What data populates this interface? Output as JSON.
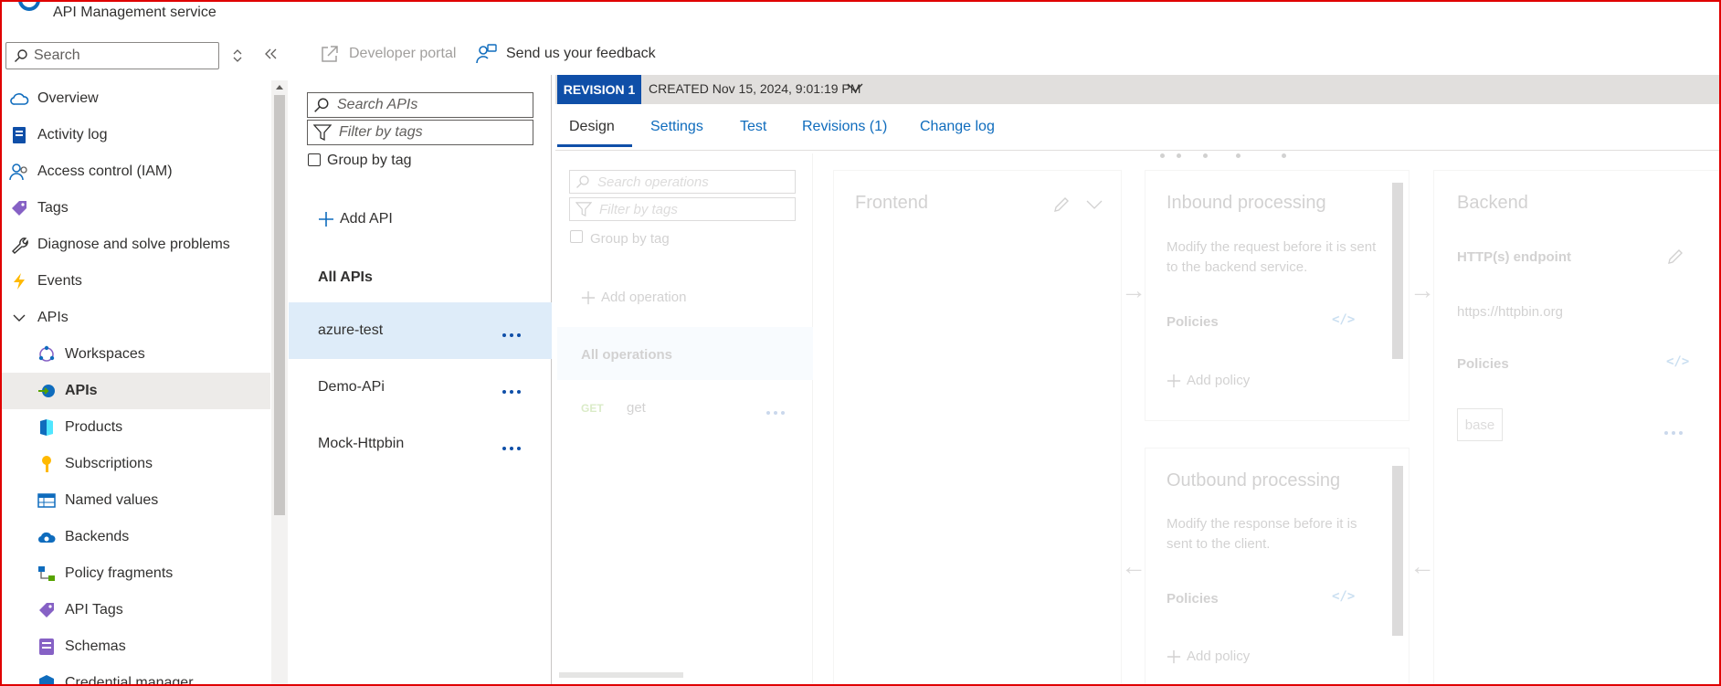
{
  "header": {
    "service_name": "API Management service"
  },
  "sidebar": {
    "search_placeholder": "Search",
    "items": [
      {
        "label": "Overview",
        "icon": "cloud-icon"
      },
      {
        "label": "Activity log",
        "icon": "log-icon"
      },
      {
        "label": "Access control (IAM)",
        "icon": "people-icon"
      },
      {
        "label": "Tags",
        "icon": "tag-icon"
      },
      {
        "label": "Diagnose and solve problems",
        "icon": "wrench-icon"
      },
      {
        "label": "Events",
        "icon": "lightning-icon"
      },
      {
        "label": "APIs",
        "icon": "chevron-down-icon"
      },
      {
        "label": "Workspaces",
        "icon": "workspaces-icon"
      },
      {
        "label": "APIs",
        "icon": "api-icon"
      },
      {
        "label": "Products",
        "icon": "products-icon"
      },
      {
        "label": "Subscriptions",
        "icon": "key-icon"
      },
      {
        "label": "Named values",
        "icon": "table-icon"
      },
      {
        "label": "Backends",
        "icon": "backends-icon"
      },
      {
        "label": "Policy fragments",
        "icon": "fragments-icon"
      },
      {
        "label": "API Tags",
        "icon": "tag-icon"
      },
      {
        "label": "Schemas",
        "icon": "schemas-icon"
      },
      {
        "label": "Credential manager",
        "icon": "credential-icon"
      }
    ]
  },
  "toolbar": {
    "developer_portal": "Developer portal",
    "feedback": "Send us your feedback"
  },
  "apis_panel": {
    "search_placeholder": "Search APIs",
    "filter_placeholder": "Filter by tags",
    "group_by_tag": "Group by tag",
    "add_api": "Add API",
    "all_apis": "All APIs",
    "apis": [
      "azure-test",
      "Demo-APi",
      "Mock-Httpbin"
    ]
  },
  "revision": {
    "badge": "REVISION 1",
    "created": "CREATED Nov 15, 2024, 9:01:19 PM"
  },
  "tabs": [
    "Design",
    "Settings",
    "Test",
    "Revisions (1)",
    "Change log"
  ],
  "design": {
    "search_operations": "Search operations",
    "filter_by_tags": "Filter by tags",
    "group_by_tag": "Group by tag",
    "add_operation": "Add operation",
    "all_operations": "All operations",
    "operation_method": "GET",
    "operation_name": "get",
    "frontend_title": "Frontend",
    "inbound_title": "Inbound processing",
    "inbound_desc": "Modify the request before it is sent to the backend service.",
    "outbound_title": "Outbound processing",
    "outbound_desc": "Modify the response before it is sent to the client.",
    "policies": "Policies",
    "add_policy": "Add policy",
    "backend_title": "Backend",
    "http_endpoint": "HTTP(s) endpoint",
    "backend_url": "https://httpbin.org",
    "base": "base"
  },
  "colors": {
    "accent": "#0f4fa8",
    "link": "#0f6cbd",
    "selected_row": "#deecf9",
    "frame": "#e00000"
  }
}
